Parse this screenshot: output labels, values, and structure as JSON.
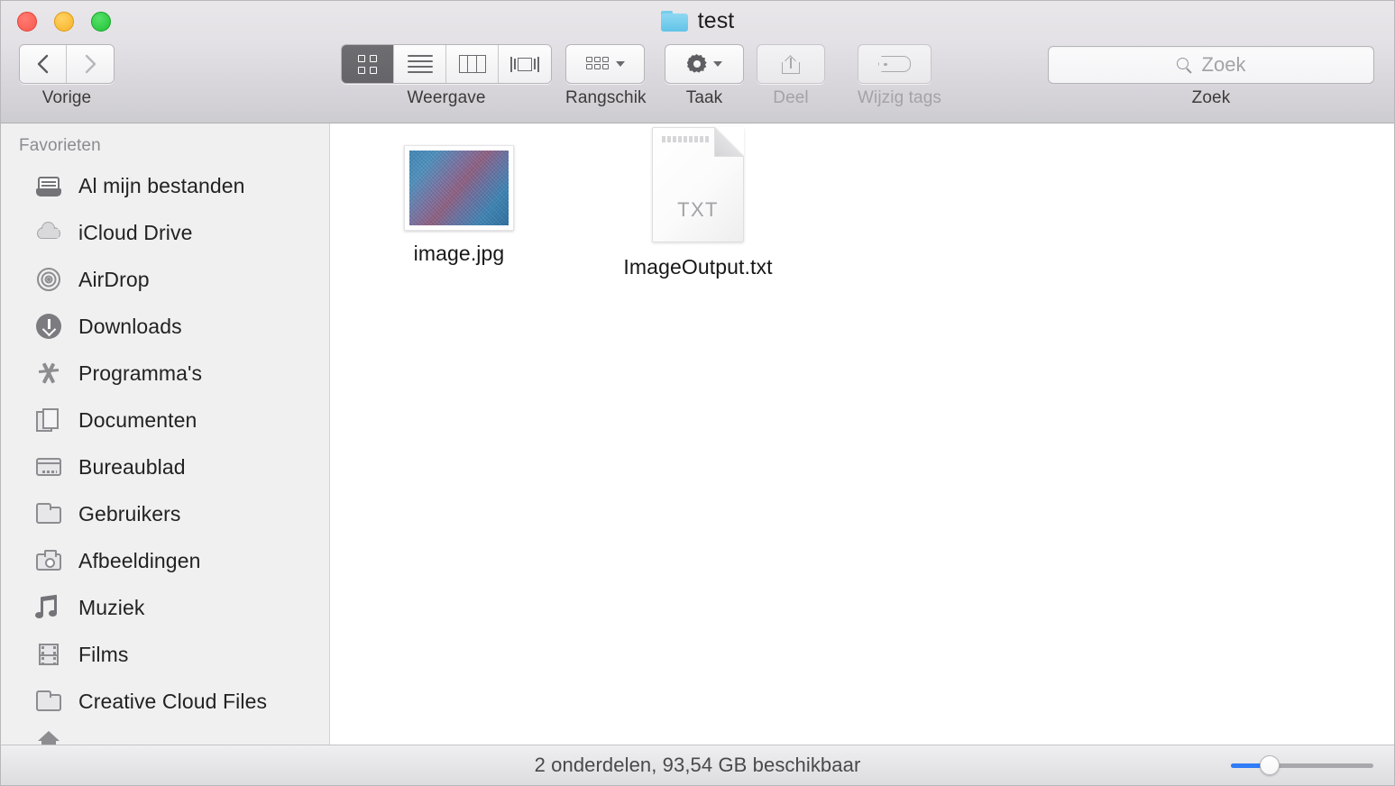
{
  "window": {
    "title": "test",
    "folder_icon": "folder-icon",
    "traffic_lights": {
      "close": "close-button",
      "minimize": "minimize-button",
      "zoom": "zoom-button",
      "close_color": "#f8584e",
      "minimize_color": "#f8b227",
      "zoom_color": "#1fc235"
    }
  },
  "toolbar": {
    "nav": {
      "label": "Vorige",
      "back_icon": "chevron-left-icon",
      "forward_icon": "chevron-right-icon"
    },
    "view": {
      "label": "Weergave",
      "options": [
        "icon-view",
        "list-view",
        "column-view",
        "coverflow-view"
      ],
      "selected": "icon-view"
    },
    "arrange": {
      "label": "Rangschik",
      "icon": "arrange-grid-icon",
      "chevron": "chevron-down-icon"
    },
    "action": {
      "label": "Taak",
      "icon": "gear-icon",
      "chevron": "chevron-down-icon"
    },
    "share": {
      "label": "Deel",
      "icon": "share-icon",
      "disabled": true
    },
    "tags": {
      "label": "Wijzig tags",
      "icon": "tag-icon",
      "disabled": true
    },
    "search": {
      "label": "Zoek",
      "placeholder": "Zoek",
      "value": "",
      "icon": "search-icon"
    }
  },
  "sidebar": {
    "header": "Favorieten",
    "items": [
      {
        "label": "Al mijn bestanden",
        "icon": "all-my-files-icon"
      },
      {
        "label": "iCloud Drive",
        "icon": "icloud-drive-icon"
      },
      {
        "label": "AirDrop",
        "icon": "airdrop-icon"
      },
      {
        "label": "Downloads",
        "icon": "downloads-icon"
      },
      {
        "label": "Programma's",
        "icon": "applications-icon"
      },
      {
        "label": "Documenten",
        "icon": "documents-icon"
      },
      {
        "label": "Bureaublad",
        "icon": "desktop-icon"
      },
      {
        "label": "Gebruikers",
        "icon": "folder-icon"
      },
      {
        "label": "Afbeeldingen",
        "icon": "pictures-camera-icon"
      },
      {
        "label": "Muziek",
        "icon": "music-note-icon"
      },
      {
        "label": "Films",
        "icon": "film-strip-icon"
      },
      {
        "label": "Creative Cloud Files",
        "icon": "folder-icon"
      },
      {
        "label": "",
        "icon": "home-icon"
      }
    ]
  },
  "content": {
    "files": [
      {
        "name": "image.jpg",
        "kind": "image-thumbnail"
      },
      {
        "name": "ImageOutput.txt",
        "kind": "text-document",
        "extension_label": "TXT"
      }
    ]
  },
  "statusbar": {
    "text": "2 onderdelen, 93,54 GB beschikbaar",
    "zoom_slider": {
      "value_percent": 25,
      "fill_color": "#2f7cf6"
    }
  }
}
